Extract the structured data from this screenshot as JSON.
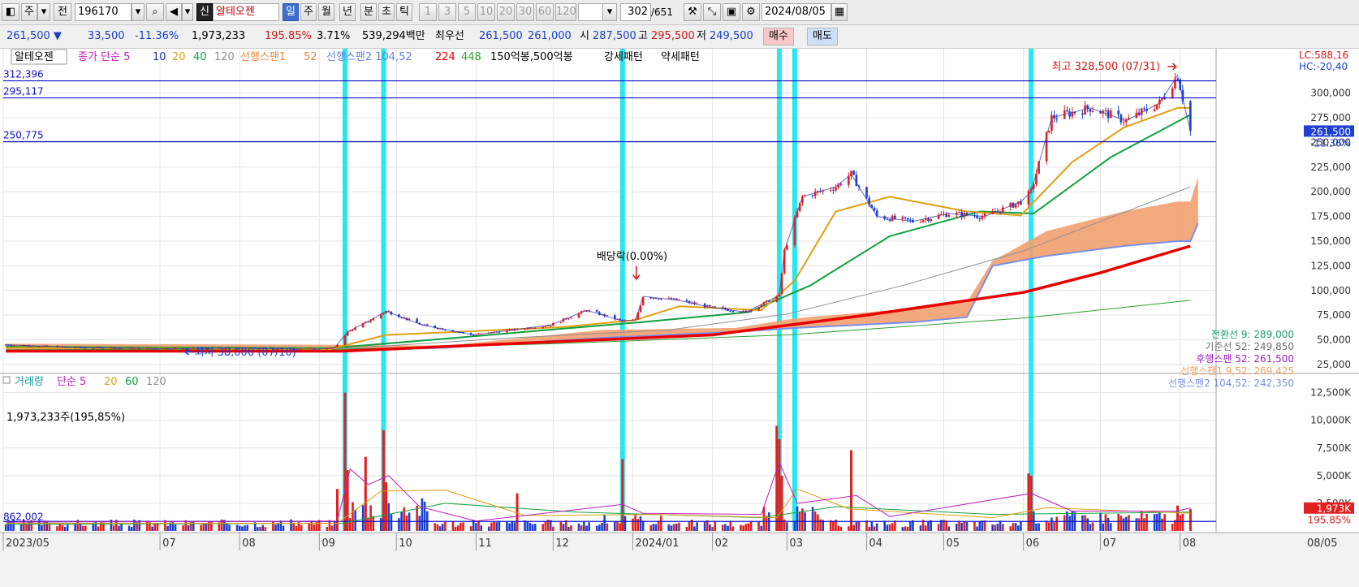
{
  "toolbar": {
    "btn_ju": "주",
    "btn_jeon": "전",
    "stock_code": "196170",
    "btn_sin": "신",
    "stock_name": "알테오젠",
    "periods": [
      "일",
      "주",
      "월",
      "년",
      "분",
      "초",
      "틱"
    ],
    "active_period": "일",
    "multipliers": [
      "1",
      "3",
      "5",
      "10",
      "20",
      "30",
      "60",
      "120"
    ],
    "page_count": "302",
    "page_total": "/651",
    "date": "2024/08/05"
  },
  "quote": {
    "price": "261,500",
    "change": "33,500",
    "change_pct": "-11.36%",
    "volume": "1,973,233",
    "volume_pct": "195.85%",
    "turnover_pct": "3.71%",
    "amount": "539,294백만",
    "best_ask_label": "최우선",
    "best_ask": "261,500",
    "best_bid": "261,000",
    "open_label": "시",
    "open": "287,500",
    "high_label": "고",
    "high": "295,500",
    "low_label": "저",
    "low": "249,500",
    "buy_label": "매수",
    "sell_label": "매도"
  },
  "colors": {
    "up": "#e02020",
    "down": "#1f3fd0",
    "ma5": "#c01ec0",
    "ma10": "#1f2fb0",
    "ma20": "#e0a010",
    "ma40": "#10a040",
    "ma120": "#909090",
    "cloud": "#f2a070",
    "ma224": "#e80000",
    "ma448": "#30a030",
    "vline": "#18e8f0",
    "hline": "#1010c8"
  },
  "chart_data": [
    {
      "type": "candlestick",
      "title": "알테오젠",
      "price_axis": {
        "ylim": [
          20000,
          340000
        ],
        "ticks": [
          25000,
          50000,
          75000,
          100000,
          125000,
          150000,
          175000,
          200000,
          225000,
          250000,
          275000,
          300000
        ]
      },
      "x": [
        "2023/05",
        "07",
        "08",
        "09",
        "10",
        "11",
        "12",
        "2024/01",
        "02",
        "03",
        "04",
        "05",
        "06",
        "07",
        "08"
      ],
      "x_right_label": "08/05",
      "legend_main": "알테오젠",
      "legend_ma": [
        "종가 단순 5",
        "10",
        "20",
        "40",
        "120"
      ],
      "legend_cloud": [
        "선행스팬1",
        "52",
        "선행스팬2 104,52"
      ],
      "legend_long": [
        "224",
        "448"
      ],
      "legend_extra": [
        "150억봉,500억봉",
        "강세패턴",
        "약세패턴"
      ],
      "hlines": [
        {
          "value": 312396,
          "label": "312,396"
        },
        {
          "value": 295117,
          "label": "295,117"
        },
        {
          "value": 250775,
          "label": "250,775"
        }
      ],
      "close_series": [
        [
          "2023/05/02",
          45000
        ],
        [
          "2023/06/01",
          42000
        ],
        [
          "2023/07/03",
          41000
        ],
        [
          "2023/08/01",
          41500
        ],
        [
          "2023/08/31",
          40500
        ],
        [
          "2023/09/07",
          42000
        ],
        [
          "2023/09/12",
          58000
        ],
        [
          "2023/09/21",
          70000
        ],
        [
          "2023/09/27",
          79000
        ],
        [
          "2023/10/11",
          65000
        ],
        [
          "2023/10/31",
          55000
        ],
        [
          "2023/11/15",
          60000
        ],
        [
          "2023/11/30",
          65000
        ],
        [
          "2023/12/14",
          80000
        ],
        [
          "2023/12/28",
          69000
        ],
        [
          "2024/01/02",
          70000
        ],
        [
          "2024/01/05",
          94000
        ],
        [
          "2024/01/19",
          90000
        ],
        [
          "2024/01/31",
          83000
        ],
        [
          "2024/02/14",
          78000
        ],
        [
          "2024/02/27",
          95000
        ],
        [
          "2024/02/29",
          140000
        ],
        [
          "2024/03/07",
          195000
        ],
        [
          "2024/03/20",
          205000
        ],
        [
          "2024/03/26",
          218000
        ],
        [
          "2024/04/05",
          175000
        ],
        [
          "2024/04/19",
          170000
        ],
        [
          "2024/05/03",
          178000
        ],
        [
          "2024/05/17",
          175000
        ],
        [
          "2024/05/31",
          190000
        ],
        [
          "2024/06/04",
          200000
        ],
        [
          "2024/06/12",
          275000
        ],
        [
          "2024/06/27",
          285000
        ],
        [
          "2024/07/11",
          272000
        ],
        [
          "2024/07/24",
          290000
        ],
        [
          "2024/07/31",
          318000
        ],
        [
          "2024/08/02",
          295000
        ],
        [
          "2024/08/05",
          261500
        ]
      ],
      "ma20_series": [
        [
          "2023/05/02",
          42000
        ],
        [
          "2023/09/05",
          40500
        ],
        [
          "2023/09/27",
          55000
        ],
        [
          "2023/10/25",
          58000
        ],
        [
          "2023/12/05",
          63000
        ],
        [
          "2024/01/02",
          70000
        ],
        [
          "2024/01/19",
          84000
        ],
        [
          "2024/02/20",
          80000
        ],
        [
          "2024/03/04",
          110000
        ],
        [
          "2024/03/20",
          180000
        ],
        [
          "2024/04/10",
          195000
        ],
        [
          "2024/05/10",
          180000
        ],
        [
          "2024/05/31",
          176000
        ],
        [
          "2024/06/20",
          230000
        ],
        [
          "2024/07/10",
          265000
        ],
        [
          "2024/07/31",
          285000
        ],
        [
          "2024/08/05",
          285000
        ]
      ],
      "ma40_series": [
        [
          "2023/05/02",
          43000
        ],
        [
          "2023/09/05",
          41500
        ],
        [
          "2023/10/15",
          50000
        ],
        [
          "2023/11/20",
          58000
        ],
        [
          "2024/01/05",
          68000
        ],
        [
          "2024/02/15",
          78000
        ],
        [
          "2024/03/10",
          105000
        ],
        [
          "2024/04/10",
          155000
        ],
        [
          "2024/05/15",
          180000
        ],
        [
          "2024/06/05",
          178000
        ],
        [
          "2024/07/05",
          235000
        ],
        [
          "2024/08/05",
          278000
        ]
      ],
      "ma120_series": [
        [
          "2023/05/02",
          42000
        ],
        [
          "2023/09/10",
          41000
        ],
        [
          "2023/11/15",
          52000
        ],
        [
          "2024/01/15",
          60000
        ],
        [
          "2024/03/01",
          76000
        ],
        [
          "2024/04/15",
          105000
        ],
        [
          "2024/06/01",
          140000
        ],
        [
          "2024/07/01",
          170000
        ],
        [
          "2024/08/05",
          205000
        ]
      ],
      "ma224_series": [
        [
          "2023/05/02",
          38500
        ],
        [
          "2023/09/10",
          38500
        ],
        [
          "2023/12/01",
          48000
        ],
        [
          "2024/02/01",
          55000
        ],
        [
          "2024/04/01",
          75000
        ],
        [
          "2024/06/01",
          98000
        ],
        [
          "2024/07/01",
          118000
        ],
        [
          "2024/08/05",
          145000
        ]
      ],
      "ma448_series": [
        [
          "2023/05/02",
          40000
        ],
        [
          "2023/09/10",
          40500
        ],
        [
          "2023/12/01",
          46000
        ],
        [
          "2024/03/01",
          55000
        ],
        [
          "2024/06/01",
          72000
        ],
        [
          "2024/08/05",
          90000
        ]
      ],
      "cloud_upper": [
        [
          "2023/05/02",
          46000
        ],
        [
          "2023/09/05",
          45000
        ],
        [
          "2023/10/20",
          44000
        ],
        [
          "2023/12/20",
          60000
        ],
        [
          "2024/02/10",
          62000
        ],
        [
          "2024/03/05",
          72000
        ],
        [
          "2024/04/20",
          82000
        ],
        [
          "2024/05/10",
          88000
        ],
        [
          "2024/05/20",
          130000
        ],
        [
          "2024/06/10",
          160000
        ],
        [
          "2024/07/10",
          180000
        ],
        [
          "2024/07/31",
          190000
        ],
        [
          "2024/08/05",
          190000
        ],
        [
          "2024/08/08",
          215000
        ]
      ],
      "cloud_lower": [
        [
          "2023/05/02",
          38000
        ],
        [
          "2023/09/05",
          38000
        ],
        [
          "2023/10/20",
          42000
        ],
        [
          "2023/12/20",
          52000
        ],
        [
          "2024/02/10",
          58000
        ],
        [
          "2024/03/05",
          62000
        ],
        [
          "2024/04/20",
          68000
        ],
        [
          "2024/05/10",
          73000
        ],
        [
          "2024/05/20",
          125000
        ],
        [
          "2024/06/10",
          135000
        ],
        [
          "2024/07/10",
          145000
        ],
        [
          "2024/07/31",
          150000
        ],
        [
          "2024/08/05",
          150000
        ],
        [
          "2024/08/08",
          168000
        ]
      ],
      "vertical_markers": [
        "2023/09/11",
        "2023/09/26",
        "2023/12/28",
        "2024/02/27",
        "2024/03/04",
        "2024/06/04"
      ],
      "annotations": [
        {
          "text": "최고 328,500 (07/31)",
          "date": "2024/07/31",
          "value": 328500
        },
        {
          "text": "최저 38,000 (07/10)",
          "date": "2023/07/10",
          "value": 38000
        },
        {
          "text": "배당락(0.00%)",
          "date": "2023/12/28",
          "value": 100000
        }
      ],
      "last_price": {
        "label": "261,500",
        "change": "-11.36%"
      },
      "top_right": [
        "LC:588,16",
        "HC:-20,40"
      ],
      "ichimoku_labels": [
        {
          "name": "전환선 9",
          "value": "289,000"
        },
        {
          "name": "기준선 52",
          "value": "249,850"
        },
        {
          "name": "후행스팬 52",
          "value": "261,500"
        },
        {
          "name": "선행스팬1 9,52",
          "value": "269,425"
        },
        {
          "name": "선행스팬2 104,52",
          "value": "242,350"
        }
      ]
    },
    {
      "type": "bar",
      "title": "거래량",
      "legend": [
        "거래량",
        "단순 5",
        "20",
        "60",
        "120"
      ],
      "volume_label": "1,973,233주(195,85%)",
      "volume_axis": {
        "ylim": [
          0,
          13500000
        ],
        "ticks": [
          2500000,
          5000000,
          7500000,
          10000000,
          12500000
        ],
        "tick_labels": [
          "2,500K",
          "5,000K",
          "7,500K",
          "10,000K",
          "12,500K"
        ]
      },
      "hline": {
        "value": 862002,
        "label": "862,002"
      },
      "last_volume": {
        "label": "1,973K",
        "pct": "195.85%"
      },
      "spikes": [
        [
          "2023/09/08",
          3800000
        ],
        [
          "2023/09/11",
          12500000
        ],
        [
          "2023/09/12",
          5500000
        ],
        [
          "2023/09/19",
          6700000
        ],
        [
          "2023/09/26",
          9100000
        ],
        [
          "2023/09/27",
          4400000
        ],
        [
          "2023/11/17",
          3400000
        ],
        [
          "2023/12/28",
          6500000
        ],
        [
          "2024/02/26",
          9500000
        ],
        [
          "2024/02/27",
          8300000
        ],
        [
          "2024/02/28",
          5000000
        ],
        [
          "2024/03/26",
          7300000
        ],
        [
          "2024/06/03",
          5200000
        ],
        [
          "2024/06/04",
          5000000
        ],
        [
          "2024/07/31",
          2300000
        ],
        [
          "2024/08/05",
          2000000
        ]
      ]
    }
  ]
}
